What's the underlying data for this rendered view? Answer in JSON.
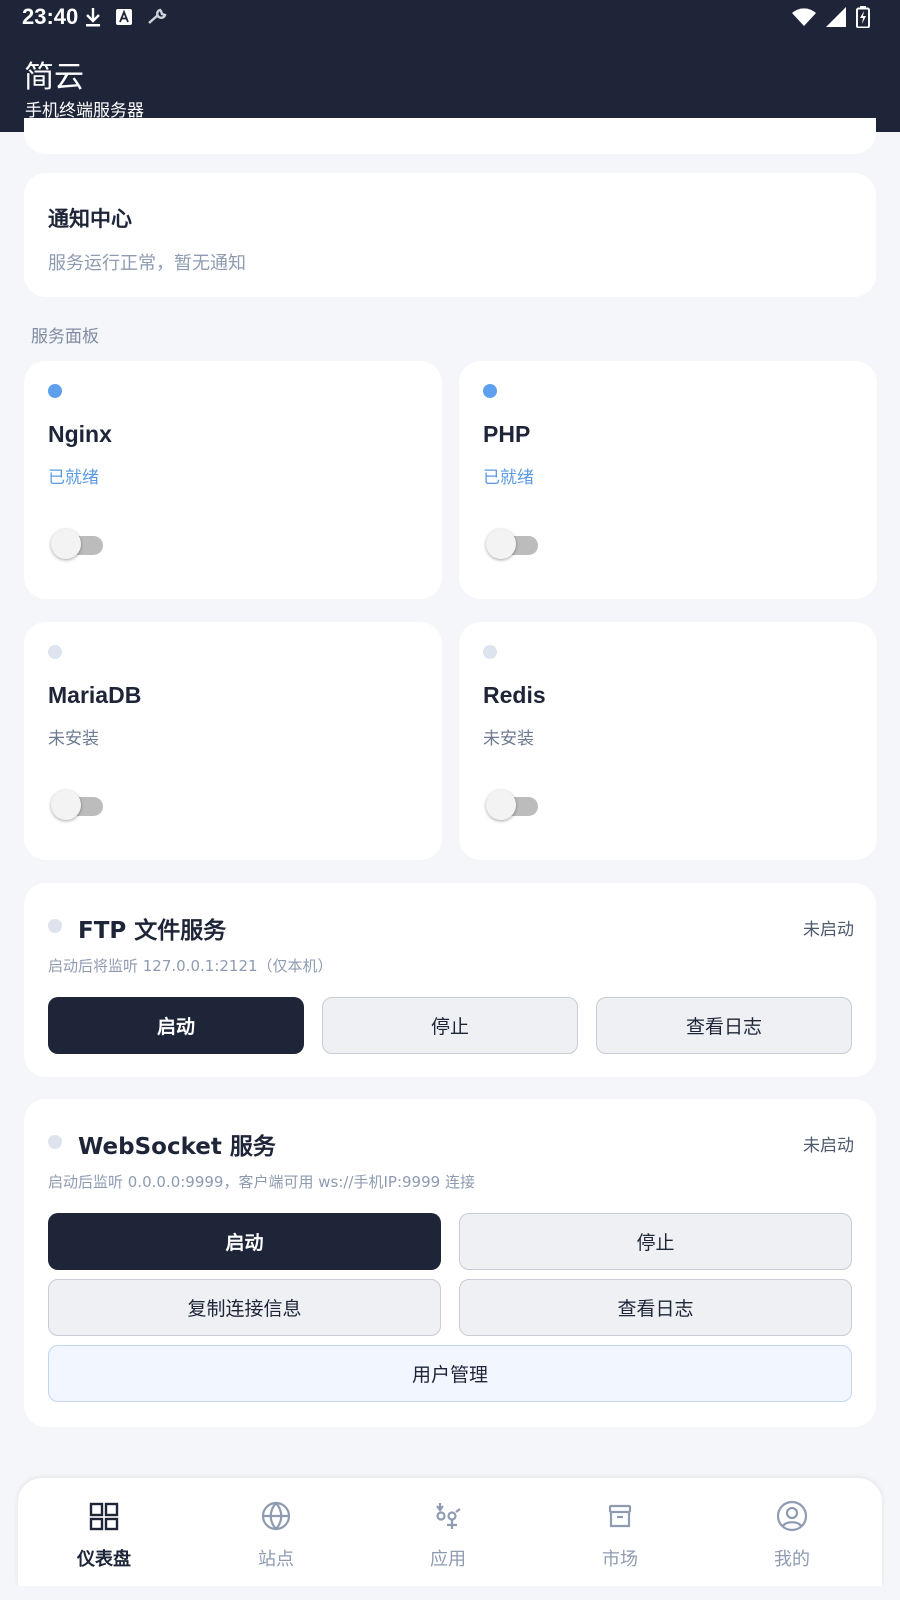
{
  "status_bar": {
    "time": "23:40",
    "left_icons": [
      "download-icon",
      "font-a-icon",
      "wrench-icon"
    ],
    "right_icons": [
      "wifi-icon",
      "signal-icon",
      "battery-charging-icon"
    ]
  },
  "app": {
    "title": "简云",
    "subtitle": "手机终端服务器"
  },
  "notice": {
    "title": "通知中心",
    "message": "服务运行正常，暂无通知"
  },
  "services_section": {
    "label": "服务面板"
  },
  "services": [
    {
      "name": "Nginx",
      "status": "已就绪",
      "state": "ready",
      "enabled": false
    },
    {
      "name": "PHP",
      "status": "已就绪",
      "state": "ready",
      "enabled": false
    },
    {
      "name": "MariaDB",
      "status": "未安装",
      "state": "not-installed",
      "enabled": false
    },
    {
      "name": "Redis",
      "status": "未安装",
      "state": "not-installed",
      "enabled": false
    }
  ],
  "ftp": {
    "title": "FTP 文件服务",
    "state": "未启动",
    "description": "启动后将监听 127.0.0.1:2121（仅本机）",
    "buttons": {
      "start": "启动",
      "stop": "停止",
      "logs": "查看日志"
    }
  },
  "websocket": {
    "title": "WebSocket 服务",
    "state": "未启动",
    "description": "启动后监听 0.0.0.0:9999，客户端可用 ws://手机IP:9999 连接",
    "buttons": {
      "start": "启动",
      "stop": "停止",
      "copy": "复制连接信息",
      "logs": "查看日志",
      "users": "用户管理"
    }
  },
  "bottom_nav": [
    {
      "label": "仪表盘",
      "icon": "dashboard-icon",
      "active": true
    },
    {
      "label": "站点",
      "icon": "globe-icon",
      "active": false
    },
    {
      "label": "应用",
      "icon": "apps-icon",
      "active": false
    },
    {
      "label": "市场",
      "icon": "archive-box-icon",
      "active": false
    },
    {
      "label": "我的",
      "icon": "user-circle-icon",
      "active": false
    }
  ],
  "colors": {
    "primary": "#1e2539",
    "accent": "#5fa0ee",
    "background": "#f4f6f9",
    "muted_text": "#8e9bb1"
  }
}
